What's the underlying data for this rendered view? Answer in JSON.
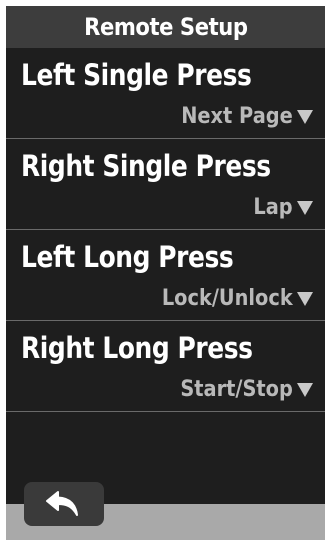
{
  "header": {
    "title": "Remote Setup"
  },
  "rows": [
    {
      "label": "Left Single Press",
      "value": "Next Page"
    },
    {
      "label": "Right Single Press",
      "value": "Lap"
    },
    {
      "label": "Left Long Press",
      "value": "Lock/Unlock"
    },
    {
      "label": "Right Long Press",
      "value": "Start/Stop"
    }
  ],
  "icons": {
    "back": "back-arrow-icon",
    "dropdown": "dropdown-triangle-icon"
  },
  "colors": {
    "background": "#1e1e1e",
    "header": "#3d3d3d",
    "footer": "#a9a9a9",
    "label": "#ffffff",
    "value": "#b9b9b9"
  }
}
